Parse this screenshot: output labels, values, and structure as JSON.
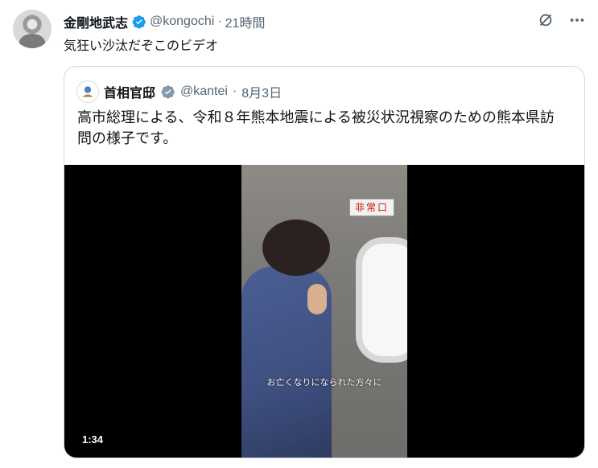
{
  "tweet": {
    "author_name": "金剛地武志",
    "handle": "@kongochi",
    "time": "21時間",
    "text": "気狂い沙汰だぞこのビデオ"
  },
  "top_actions": {
    "grok_icon": "grok-icon",
    "more_icon": "more-icon"
  },
  "quote": {
    "author_name": "首相官邸",
    "handle": "@kantei",
    "date": "8月3日",
    "text": "高市総理による、令和８年熊本地震による被災状況視察のための熊本県訪問の様子です。",
    "video": {
      "sign_text": "非常口",
      "caption": "お亡くなりになられた方々に",
      "duration": "1:34"
    }
  },
  "colors": {
    "verified": "#1d9bf0",
    "gray_verified": "#829aab",
    "muted_text": "#536471",
    "border": "#cfd9de"
  }
}
